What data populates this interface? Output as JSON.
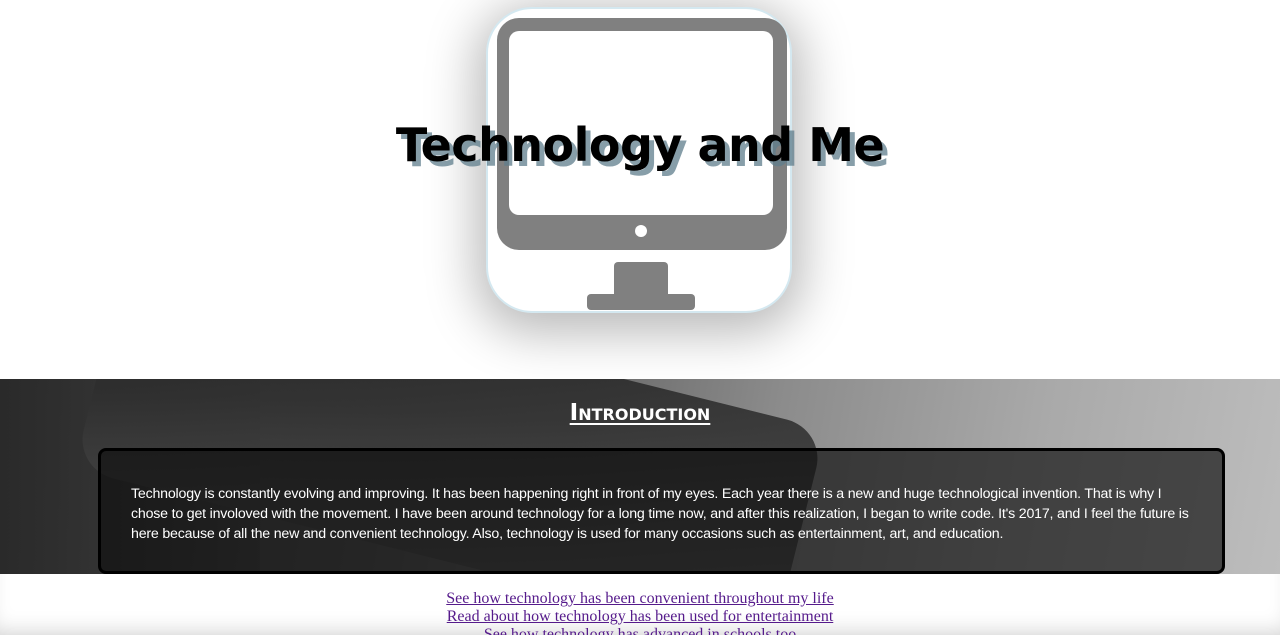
{
  "hero": {
    "title": "Technology and Me",
    "icon": "desktop-monitor-icon"
  },
  "intro": {
    "heading": "Introduction",
    "body": "Technology is constantly evolving and improving. It has been happening right in front of my eyes. Each year there is a new and huge technological invention. That is why I chose to get involoved with the movement. I have been around technology for a long time now, and after this realization, I began to write code. It's 2017, and I feel the future is here because of all the new and convenient technology. Also, technology is used for many occasions such as entertainment, art, and education."
  },
  "links": [
    {
      "label": "See how technology has been convenient throughout my life"
    },
    {
      "label": "Read about how technology has been used for entertainment"
    },
    {
      "label": "See how technology has advanced in schools too"
    }
  ],
  "colors": {
    "link": "#551a8b",
    "title_shadow": "#5f7d8c",
    "icon_gray": "#808080"
  }
}
